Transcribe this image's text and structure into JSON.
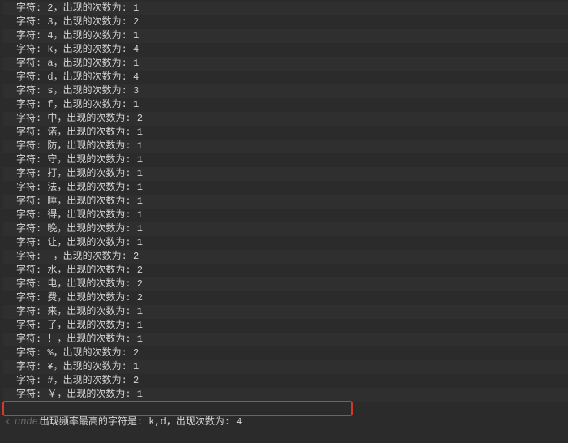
{
  "label_char": "字符: ",
  "label_sep": "，",
  "label_count": "出现的次数为: ",
  "rows": [
    {
      "ch": "2",
      "count": 1
    },
    {
      "ch": "3",
      "count": 2
    },
    {
      "ch": "4",
      "count": 1
    },
    {
      "ch": "k",
      "count": 4
    },
    {
      "ch": "a",
      "count": 1
    },
    {
      "ch": "d",
      "count": 4
    },
    {
      "ch": "s",
      "count": 3
    },
    {
      "ch": "f",
      "count": 1
    },
    {
      "ch": "中",
      "count": 2
    },
    {
      "ch": "诺",
      "count": 1
    },
    {
      "ch": "防",
      "count": 1
    },
    {
      "ch": "守",
      "count": 1
    },
    {
      "ch": "打",
      "count": 1
    },
    {
      "ch": "法",
      "count": 1
    },
    {
      "ch": "睡",
      "count": 1
    },
    {
      "ch": "得",
      "count": 1
    },
    {
      "ch": "晚",
      "count": 1
    },
    {
      "ch": "让",
      "count": 1
    },
    {
      "ch": " ",
      "count": 2
    },
    {
      "ch": "水",
      "count": 2
    },
    {
      "ch": "电",
      "count": 2
    },
    {
      "ch": "费",
      "count": 2
    },
    {
      "ch": "来",
      "count": 1
    },
    {
      "ch": "了",
      "count": 1
    },
    {
      "ch": "！",
      "count": 1
    },
    {
      "ch": "%",
      "count": 2
    },
    {
      "ch": "¥",
      "count": 1
    },
    {
      "ch": "#",
      "count": 2
    },
    {
      "ch": "￥",
      "count": 1
    }
  ],
  "summary": {
    "prefix": "出现频率最高的字符是: ",
    "chars": "k,d",
    "sep": "，",
    "count_label": "出现次数为: ",
    "count": 4
  },
  "prompt": {
    "chevron": "‹",
    "text": "undefined"
  }
}
